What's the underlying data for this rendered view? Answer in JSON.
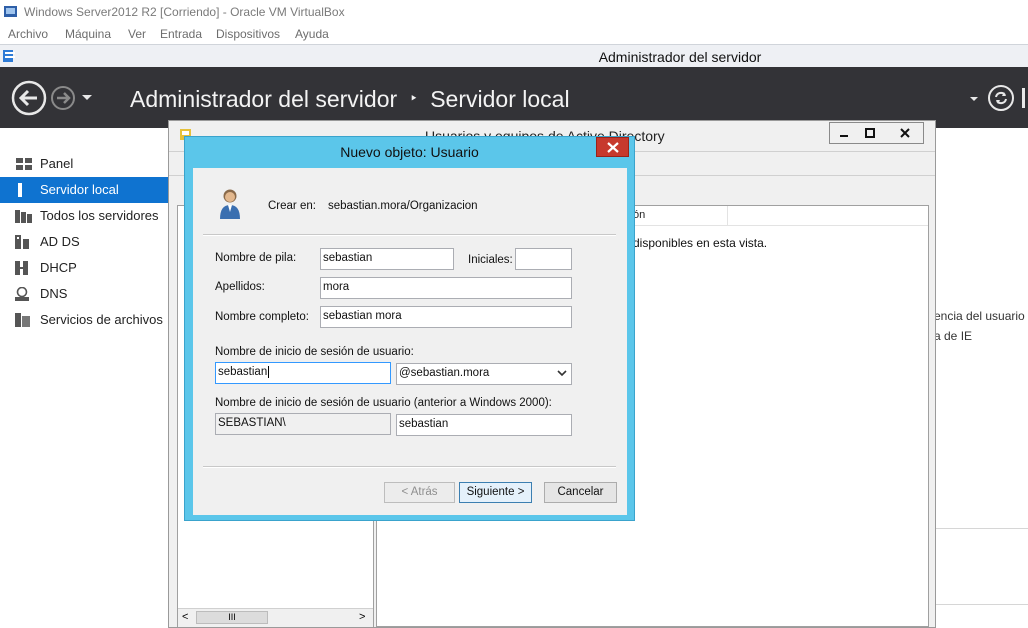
{
  "vbox": {
    "title": "Windows Server2012 R2 [Corriendo] - Oracle VM VirtualBox",
    "menu": [
      "Archivo",
      "Máquina",
      "Ver",
      "Entrada",
      "Dispositivos",
      "Ayuda"
    ]
  },
  "server_manager": {
    "window_title": "Administrador del servidor",
    "breadcrumb": {
      "root": "Administrador del servidor",
      "separator": "‣",
      "current": "Servidor local"
    },
    "nav": [
      {
        "label": "Panel",
        "icon": "dashboard-icon"
      },
      {
        "label": "Servidor local",
        "icon": "local-server-icon",
        "active": true
      },
      {
        "label": "Todos los servidores",
        "icon": "all-servers-icon"
      },
      {
        "label": "AD DS",
        "icon": "ad-ds-icon"
      },
      {
        "label": "DHCP",
        "icon": "dhcp-icon"
      },
      {
        "label": "DNS",
        "icon": "dns-icon"
      },
      {
        "label": "Servicios de archivos",
        "icon": "file-services-icon"
      }
    ],
    "right_text_1": "encia del usuario",
    "right_text_2": "a de IE",
    "accent": "#0f73d0",
    "header_bg": "#333337"
  },
  "aduc": {
    "title": "Usuarios y equipos de Active Directory",
    "column_header_partial": "ón",
    "empty_message": "disponibles en esta vista.",
    "scroll_label": "III"
  },
  "dialog": {
    "title": "Nuevo objeto: Usuario",
    "create_in_label": "Crear en:",
    "create_in_value": "sebastian.mora/Organizacion",
    "first_name_label": "Nombre de pila:",
    "first_name_value": "sebastian",
    "initials_label": "Iniciales:",
    "initials_value": "",
    "last_name_label": "Apellidos:",
    "last_name_value": "mora",
    "full_name_label": "Nombre completo:",
    "full_name_value": "sebastian mora",
    "logon_label": "Nombre de inicio de sesión de usuario:",
    "logon_value": "sebastian",
    "domain_value": "@sebastian.mora",
    "logon_pre2000_label": "Nombre de inicio de sesión de usuario (anterior a Windows 2000):",
    "pre2000_domain_value": "SEBASTIAN\\",
    "pre2000_user_value": "sebastian",
    "back_button": "< Atrás",
    "next_button": "Siguiente >",
    "cancel_button": "Cancelar",
    "title_bg": "#5bc6ea",
    "close_bg": "#c7392d"
  }
}
